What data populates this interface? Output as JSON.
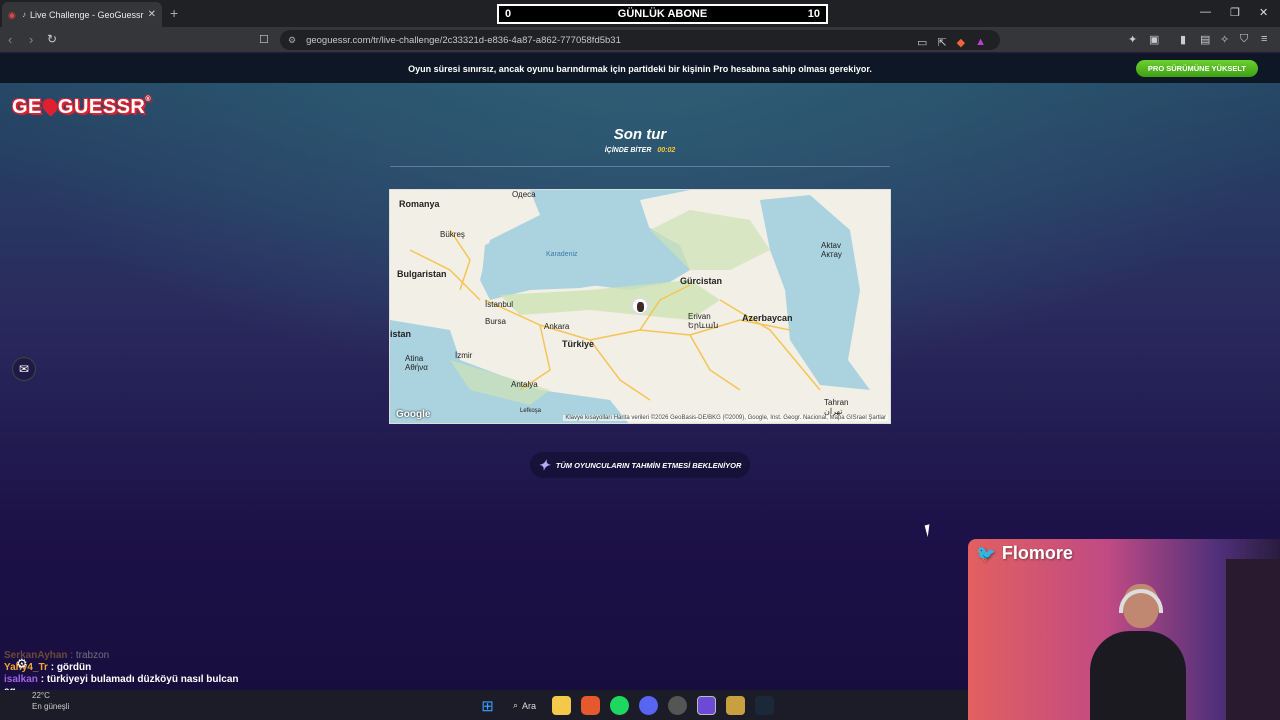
{
  "browser": {
    "tab_title": "Live Challenge - GeoGuessr",
    "new_tab": "+",
    "url": "geoguessr.com/tr/live-challenge/2c33321d-e836-4a87-a862-777058fd5b31"
  },
  "overlay_counter": {
    "left": "0",
    "title": "GÜNLÜK ABONE",
    "right": "10"
  },
  "banner": {
    "text": "Oyun süresi sınırsız, ancak oyunu barındırmak için partideki bir kişinin Pro hesabına sahip olması gerekiyor.",
    "pro_button": "PRO SÜRÜMÜNE YÜKSELT"
  },
  "logo": {
    "text_left": "GE",
    "text_right": "GUESSR",
    "reg": "®"
  },
  "round": {
    "title": "Son tur",
    "ends_label": "İÇİNDE BİTER",
    "time": "00:02"
  },
  "map": {
    "labels": [
      {
        "text": "Romanya",
        "sm": false
      },
      {
        "text": "Bükreş",
        "sm": true
      },
      {
        "text": "Bulgaristan",
        "sm": false
      },
      {
        "text": "İstanbul",
        "sm": true
      },
      {
        "text": "Bursa",
        "sm": true
      },
      {
        "text": "Ankara",
        "sm": true
      },
      {
        "text": "Türkiye",
        "sm": false
      },
      {
        "text": "İzmir",
        "sm": true
      },
      {
        "text": "Atina Αθήνα",
        "sm": true
      },
      {
        "text": "Antalya",
        "sm": true
      },
      {
        "text": "Gürcistan",
        "sm": false
      },
      {
        "text": "Erivan Երևան",
        "sm": true
      },
      {
        "text": "Azerbaycan",
        "sm": false
      },
      {
        "text": "Aktav Актау",
        "sm": true
      },
      {
        "text": "Tahran تهران",
        "sm": true
      },
      {
        "text": "Одеса",
        "sm": true
      },
      {
        "text": "istan",
        "sm": false
      },
      {
        "text": "Lefkoşa",
        "sm": true
      }
    ],
    "sea": "Karadeniz",
    "google": "Google",
    "attribution": "Klavye kısayolları   Harita verileri ©2026 GeoBasis-DE/BKG (©2009), Google, Inst. Geogr. Nacional, Mapa GISrael   Şartlar"
  },
  "waiting": {
    "text": "TÜM OYUNCULARIN TAHMİN ETMESİ BEKLENİYOR"
  },
  "webcam": {
    "name": "Flomore"
  },
  "chat": [
    {
      "user": "SerkanAyhan",
      "msg": "trabzon"
    },
    {
      "user": "Yahy4_Tr",
      "msg": "gördün"
    },
    {
      "user": "isalkan",
      "msg": "türkiyeyi bulamadı düzköyü nasıl bulcan aq"
    }
  ],
  "taskbar": {
    "weather_temp": "22°C",
    "weather_desc": "En güneşli",
    "search": "Ara"
  },
  "colors": {
    "accent_green": "#5cc322",
    "logo_red": "#e0202f",
    "timer_yellow": "#f9c93a"
  }
}
